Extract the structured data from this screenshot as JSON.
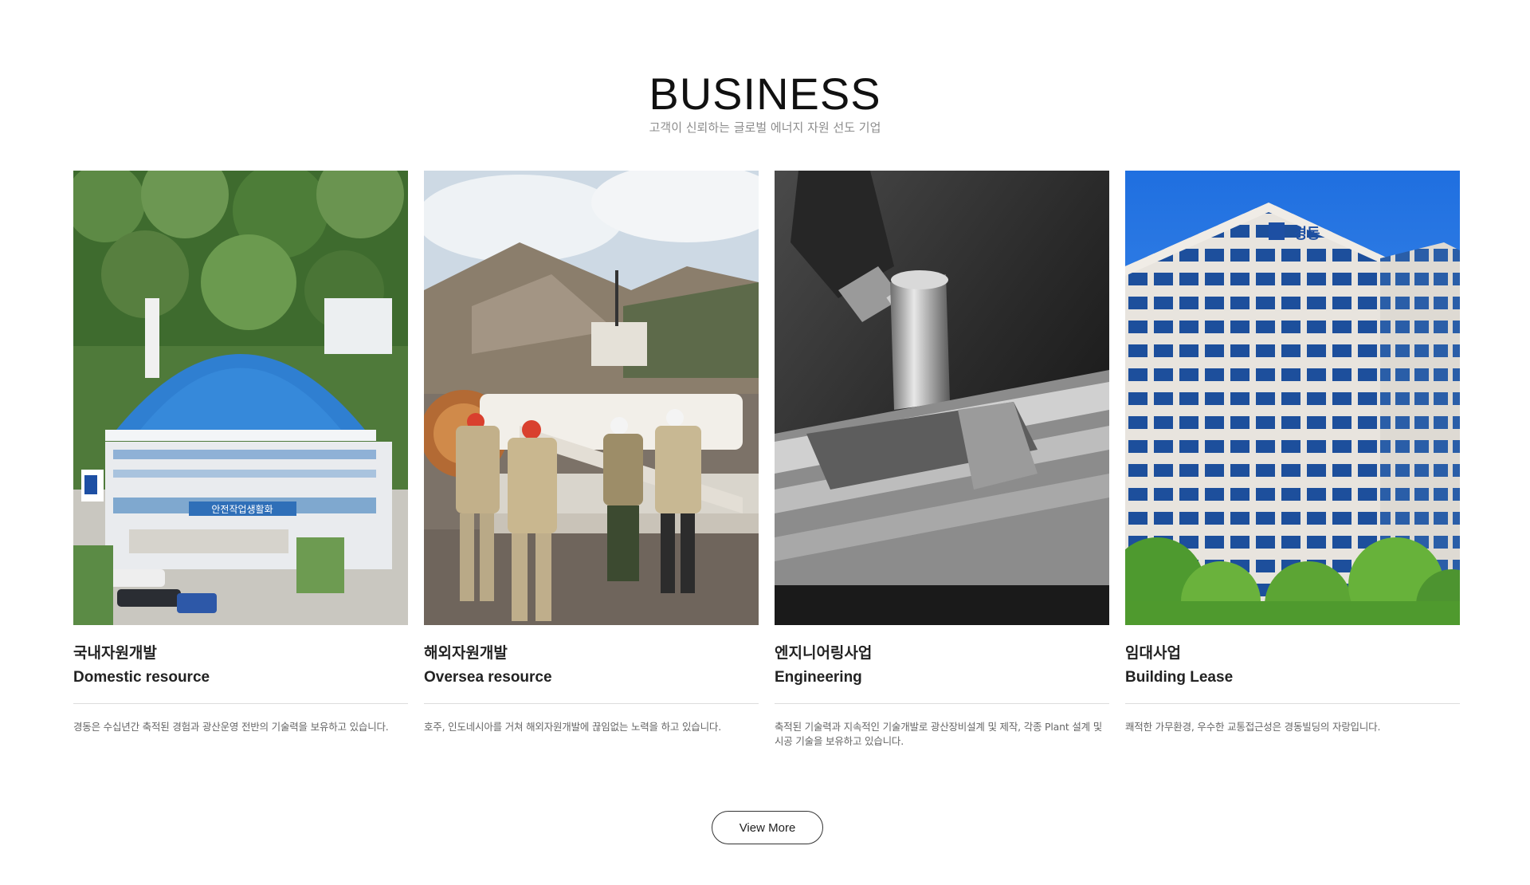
{
  "section": {
    "title": "BUSINESS",
    "subtitle": "고객이 신뢰하는 글로벌 에너지 자원 선도 기업"
  },
  "cards": [
    {
      "title_ko": "국내자원개발",
      "title_en": "Domestic resource",
      "description": "경동은 수십년간 축적된 경험과 광산운영 전반의 기술력을 보유하고 있습니다.",
      "image_icon": "domestic-mine-building-photo",
      "sign_text": "안전작업생활화"
    },
    {
      "title_ko": "해외자원개발",
      "title_en": "Oversea resource",
      "description": "호주, 인도네시아를 거쳐 해외자원개발에 끊임없는 노력을 하고 있습니다.",
      "image_icon": "oversea-miners-machine-photo"
    },
    {
      "title_ko": "엔지니어링사업",
      "title_en": "Engineering",
      "description": "축적된 기술력과 지속적인 기술개발로 광산장비설계 및 제작, 각종 Plant 설계 및 시공 기술을 보유하고 있습니다.",
      "image_icon": "engineering-milling-machine-photo"
    },
    {
      "title_ko": "임대사업",
      "title_en": "Building Lease",
      "description": "쾌적한 가무환경, 우수한 교통접근성은 경동빌딩의 자랑입니다.",
      "image_icon": "building-lease-tower-photo",
      "sign_text": "경동"
    }
  ],
  "view_more_label": "View More",
  "colors": {
    "title": "#111111",
    "subtitle": "#8c8c8c",
    "divider": "#dcdcdc",
    "description": "#666666"
  }
}
